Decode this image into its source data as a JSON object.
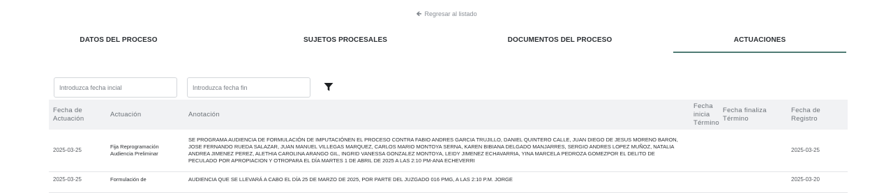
{
  "back_link": {
    "label": "Regresar al listado"
  },
  "tabs": [
    {
      "label": "DATOS DEL PROCESO",
      "active": false
    },
    {
      "label": "SUJETOS PROCESALES",
      "active": false
    },
    {
      "label": "DOCUMENTOS DEL PROCESO",
      "active": false
    },
    {
      "label": "ACTUACIONES",
      "active": true
    }
  ],
  "filters": {
    "start_placeholder": "Introduzca fecha incial",
    "end_placeholder": "Introduzca fecha fin",
    "filter_icon": "filter-icon"
  },
  "table": {
    "headers": [
      "Fecha de Actuación",
      "Actuación",
      "Anotación",
      "Fecha inicia Término",
      "Fecha finaliza Término",
      "Fecha de Registro"
    ],
    "rows": [
      {
        "fecha_actuacion": "2025-03-25",
        "actuacion": "Fija Reprogramación Audiencia Preliminar",
        "anotacion": "SE PROGRAMA AUDIENCIA DE FORMULACIÓN DE IMPUTACIÓNEN EL PROCESO CONTRA FABIO ANDRES GARCIA TRUJILLO, DANIEL QUINTERO CALLE, JUAN DIEGO DE JESUS MORENO BARON, JOSE FERNANDO RUEDA SALAZAR, JUAN MANUEL VILLEGAS MARQUEZ, CARLOS MARIO MONTOYA SERNA, KAREN BIBIANA DELGADO MANJARRES, SERGIO ANDRES LOPEZ MUÑOZ, NATALIA ANDREA JIMENEZ PEREZ, ALETHIA CAROLINA ARANGO GIL, INGRID VANESSA GONZALEZ MONTOYA, LEIDY JIMENEZ ECHAVARRIA, YINA MARCELA PEDROZA GOMEZPOR EL DELITO DE PECULADO POR APROPIACION Y OTROPARA EL DÍA MARTES 1 DE ABRIL DE 2025 A LAS 2:10 PM-ANA ECHEVERRI",
        "fecha_inicia": "",
        "fecha_finaliza": "",
        "fecha_registro": "2025-03-25"
      },
      {
        "fecha_actuacion": "2025-03-25",
        "actuacion": "Formulación de",
        "anotacion": "AUDIENCIA QUE SE LLEVARÁ A CABO EL DÍA 25 DE MARZO DE 2025, POR PARTE DEL JUZGADO 016 PMG, A LAS 2:10 P.M. JORGE",
        "fecha_inicia": "",
        "fecha_finaliza": "",
        "fecha_registro": "2025-03-20"
      }
    ]
  }
}
